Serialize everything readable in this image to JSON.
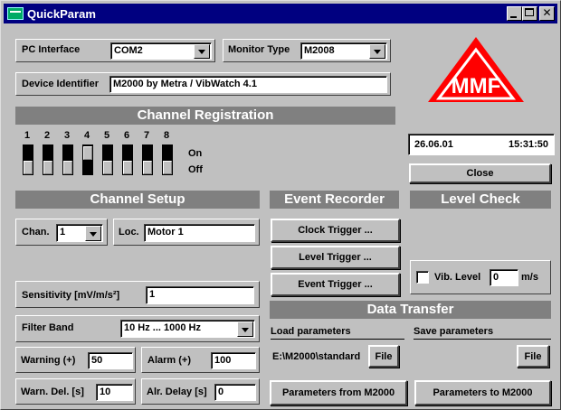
{
  "window": {
    "title": "QuickParam"
  },
  "pc_interface": {
    "label": "PC Interface",
    "value": "COM2"
  },
  "monitor_type": {
    "label": "Monitor Type",
    "value": "M2008"
  },
  "device_identifier": {
    "label": "Device Identifier",
    "value": "M2000 by Metra / VibWatch 4.1"
  },
  "channel_registration": {
    "title": "Channel Registration",
    "channels": [
      "1",
      "2",
      "3",
      "4",
      "5",
      "6",
      "7",
      "8"
    ],
    "states": [
      "off",
      "off",
      "off",
      "on",
      "off",
      "off",
      "off",
      "off"
    ],
    "on_label": "On",
    "off_label": "Off"
  },
  "datetime": {
    "date": "26.06.01",
    "time": "15:31:50"
  },
  "close_button": "Close",
  "channel_setup": {
    "title": "Channel Setup",
    "chan_label": "Chan.",
    "chan_value": "1",
    "loc_label": "Loc.",
    "loc_value": "Motor 1",
    "sensitivity_label": "Sensitivity [mV/m/s²]",
    "sensitivity_value": "1",
    "filter_label": "Filter Band",
    "filter_value": "10 Hz ... 1000 Hz",
    "warning_label": "Warning (+)",
    "warning_value": "50",
    "alarm_label": "Alarm (+)",
    "alarm_value": "100",
    "warn_delay_label": "Warn. Del. [s]",
    "warn_delay_value": "10",
    "alarm_delay_label": "Alr. Delay [s]",
    "alarm_delay_value": "0"
  },
  "event_recorder": {
    "title": "Event Recorder",
    "clock_trigger": "Clock Trigger ...",
    "level_trigger": "Level Trigger ...",
    "event_trigger": "Event Trigger ..."
  },
  "level_check": {
    "title": "Level Check",
    "vib_label": "Vib. Level",
    "vib_value": "0",
    "unit": "m/s",
    "checked": false
  },
  "data_transfer": {
    "title": "Data Transfer",
    "load_label": "Load parameters",
    "save_label": "Save parameters",
    "load_path": "E:\\M2000\\standard",
    "file_button": "File",
    "from_button": "Parameters from M2000",
    "to_button": "Parameters to M2000"
  },
  "colors": {
    "title_bar": "#000080",
    "logo_red": "#ff0000",
    "header_gray": "#808080",
    "window_gray": "#c0c0c0"
  },
  "logo": {
    "text": "MMF"
  }
}
